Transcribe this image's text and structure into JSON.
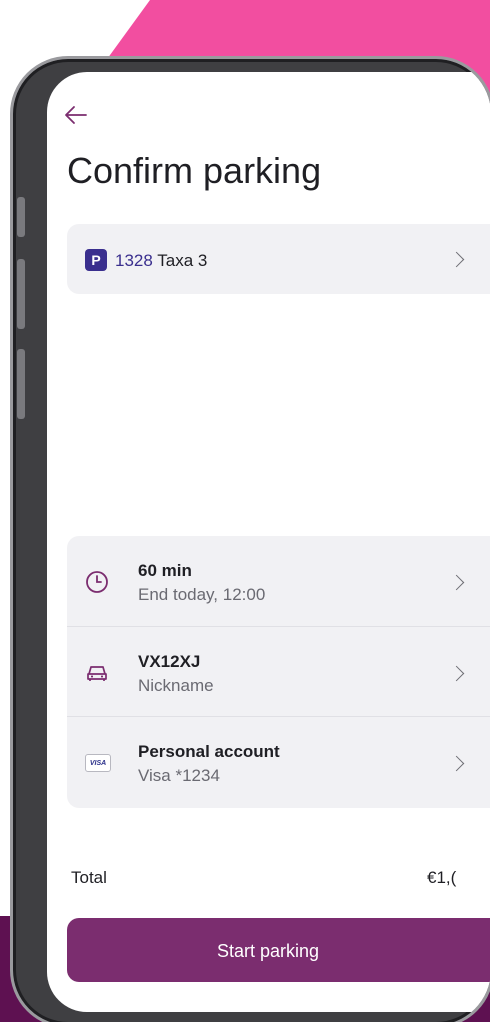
{
  "screen": {
    "title": "Confirm parking"
  },
  "zone": {
    "badge": "P",
    "code": "1328",
    "name": "Taxa 3"
  },
  "details": {
    "duration": {
      "title": "60 min",
      "subtitle": "End today, 12:00",
      "icon": "clock-icon"
    },
    "vehicle": {
      "title": "VX12XJ",
      "subtitle": "Nickname",
      "icon": "car-icon"
    },
    "payment": {
      "title": "Personal account",
      "subtitle": "Visa *1234",
      "icon": "visa-card-icon",
      "card_brand": "VISA"
    }
  },
  "total": {
    "label": "Total",
    "value": "€1,("
  },
  "actions": {
    "start_label": "Start parking"
  },
  "colors": {
    "brand_purple": "#7b2d6f",
    "dark_purple": "#5e1151",
    "accent_pink": "#f24ea0",
    "zone_blue": "#3a2f8e"
  }
}
